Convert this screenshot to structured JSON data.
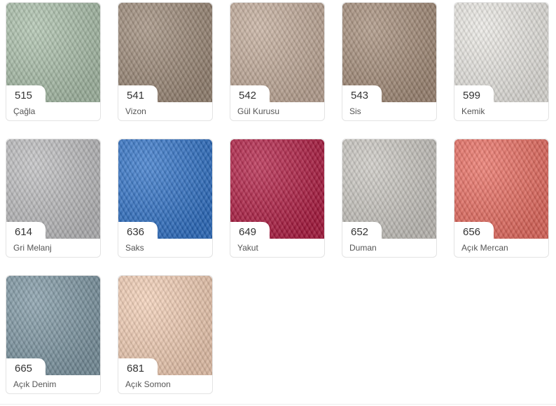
{
  "colors": [
    {
      "code": "515",
      "name": "Çağla",
      "swatch": "#a9bfa9"
    },
    {
      "code": "541",
      "name": "Vizon",
      "swatch": "#9b8775"
    },
    {
      "code": "542",
      "name": "Gül Kurusu",
      "swatch": "#c2aa98"
    },
    {
      "code": "543",
      "name": "Sis",
      "swatch": "#a48b77"
    },
    {
      "code": "599",
      "name": "Kemik",
      "swatch": "#eae8e3"
    },
    {
      "code": "614",
      "name": "Gri Melanj",
      "swatch": "#bcbcbe"
    },
    {
      "code": "636",
      "name": "Saks",
      "swatch": "#2b6fc7"
    },
    {
      "code": "649",
      "name": "Yakut",
      "swatch": "#b0173f"
    },
    {
      "code": "652",
      "name": "Duman",
      "swatch": "#c9c6c0"
    },
    {
      "code": "656",
      "name": "Açık Mercan",
      "swatch": "#ea6a5e"
    },
    {
      "code": "665",
      "name": "Açık Denim",
      "swatch": "#7b95a2"
    },
    {
      "code": "681",
      "name": "Açık Somon",
      "swatch": "#f3cdb3"
    }
  ]
}
